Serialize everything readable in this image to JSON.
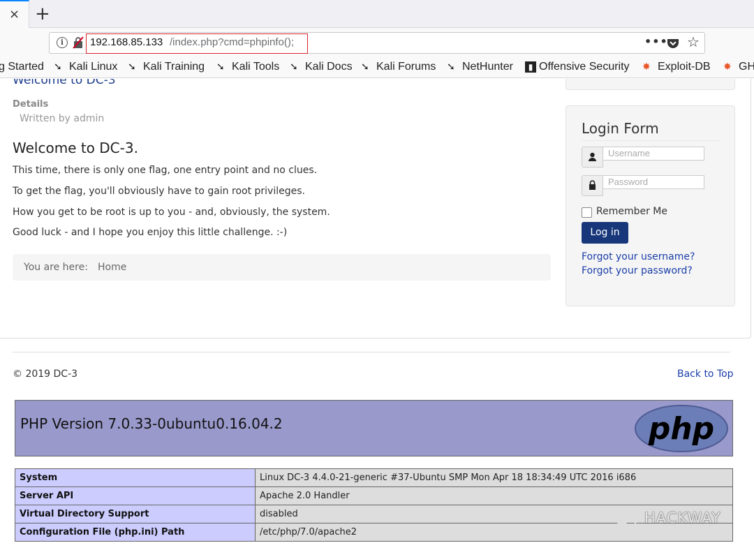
{
  "browser": {
    "tab_close": "×",
    "new_tab": "+",
    "url_host": "192.168.85.133",
    "url_path": "/index.php?cmd=phpinfo();",
    "more_label": "•••",
    "icons": [
      "info-icon",
      "insecure-lock-icon",
      "more-icon",
      "pocket-icon",
      "bookmark-star-icon"
    ]
  },
  "bookmarks": [
    {
      "label": "g Started",
      "icon": ""
    },
    {
      "label": "Kali Linux",
      "icon": "kali-icon"
    },
    {
      "label": "Kali Training",
      "icon": "kali-icon"
    },
    {
      "label": "Kali Tools",
      "icon": "kali-icon"
    },
    {
      "label": "Kali Docs",
      "icon": "kali-icon"
    },
    {
      "label": "Kali Forums",
      "icon": "kali-icon"
    },
    {
      "label": "NetHunter",
      "icon": "kali-icon"
    },
    {
      "label": "Offensive Security",
      "icon": "offsec-icon"
    },
    {
      "label": "Exploit-DB",
      "icon": "exploit-db-icon"
    },
    {
      "label": "GH",
      "icon": "exploit-db-icon"
    }
  ],
  "article": {
    "cut_title": "Welcome to DC-3",
    "details_label": "Details",
    "written_by": "Written by admin",
    "heading": "Welcome to DC-3.",
    "paragraphs": [
      "This time, there is only one flag, one entry point and no clues.",
      "To get the flag, you'll obviously have to gain root privileges.",
      "How you get to be root is up to you - and, obviously, the system.",
      "Good luck - and I hope you enjoy this little challenge.  :-)"
    ],
    "breadcrumb_label": "You are here:",
    "breadcrumb_home": "Home"
  },
  "login": {
    "title": "Login Form",
    "username_placeholder": "Username",
    "password_placeholder": "Password",
    "remember_label": "Remember Me",
    "button_label": "Log in",
    "forgot_username": "Forgot your username?",
    "forgot_password": "Forgot your password?"
  },
  "footer": {
    "copyright": "© 2019 DC-3",
    "back_to_top": "Back to Top"
  },
  "phpinfo": {
    "version": "PHP Version 7.0.33-0ubuntu0.16.04.2",
    "logo_text": "php",
    "rows": [
      {
        "key": "System",
        "value": "Linux DC-3 4.4.0-21-generic #37-Ubuntu SMP Mon Apr 18 18:34:49 UTC 2016 i686"
      },
      {
        "key": "Server API",
        "value": "Apache 2.0 Handler"
      },
      {
        "key": "Virtual Directory Support",
        "value": "disabled"
      },
      {
        "key": "Configuration File (php.ini) Path",
        "value": "/etc/php/7.0/apache2"
      }
    ]
  },
  "watermark": "HACKWAY",
  "colors": {
    "php_header": "#9999cc",
    "php_key_cell": "#ccccff",
    "php_value_cell": "#dddddd",
    "login_button": "#17377a",
    "link": "#1a3da8",
    "url_highlight_border": "#d8262c"
  }
}
